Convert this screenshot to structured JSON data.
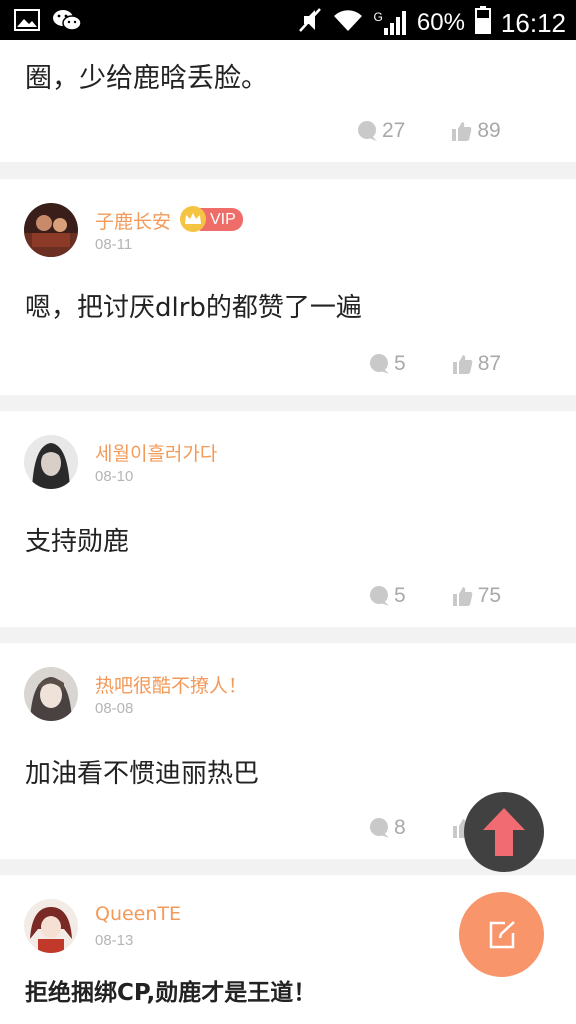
{
  "status_bar": {
    "signal_label": "G",
    "battery": "60%",
    "time": "16:12"
  },
  "top_post": {
    "text": "圈，少给鹿晗丢脸。",
    "comments": "27",
    "likes": "89"
  },
  "posts": [
    {
      "username": "子鹿长安",
      "vip": "VIP",
      "date": "08-11",
      "text": "嗯，把讨厌dlrb的都赞了一遍",
      "comments": "5",
      "likes": "87"
    },
    {
      "username": "세월이흘러가다",
      "date": "08-10",
      "text": "支持勋鹿",
      "comments": "5",
      "likes": "75"
    },
    {
      "username": "热吧很酷不撩人！",
      "date": "08-08",
      "text": "加油看不惯迪丽热巴",
      "comments": "8",
      "likes": ""
    },
    {
      "username": "QueenTE",
      "date": "08-13",
      "text": "拒绝捆绑CP,勋鹿才是王道！"
    }
  ],
  "colors": {
    "username": "#f39a5a",
    "vip_badge": "#ef6d69",
    "crown": "#f6c443",
    "fab_up": "#414141",
    "fab_up_arrow": "#f06b72",
    "fab_edit": "#f8956a"
  },
  "icons": {
    "comment": "comment-bubble-icon",
    "like": "thumbs-up-icon",
    "scroll_top": "arrow-up-icon",
    "compose": "edit-icon"
  }
}
